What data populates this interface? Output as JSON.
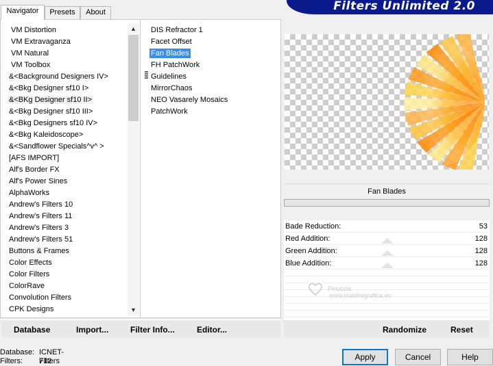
{
  "tabs": [
    "Navigator",
    "Presets",
    "About"
  ],
  "banner": {
    "title": "Filters Unlimited 2.0"
  },
  "categories": [
    "VM Distortion",
    "VM Extravaganza",
    "VM Natural",
    "VM Toolbox",
    "&<Background Designers IV>",
    "&<Bkg Designer sf10 I>",
    "&<BKg Designer sf10 II>",
    "&<Bkg Designer sf10 III>",
    "&<Bkg Designers sf10 IV>",
    "&<Bkg Kaleidoscope>",
    "&<Sandflower Specials^v^ >",
    "[AFS IMPORT]",
    "Alf's Border FX",
    "Alf's Power Sines",
    "AlphaWorks",
    "Andrew's Filters 10",
    "Andrew's Filters 11",
    "Andrew's Filters 3",
    "Andrew's Filters 51",
    "Buttons & Frames",
    "Color Effects",
    "Color Filters",
    "ColorRave",
    "Convolution Filters",
    "CPK Designs"
  ],
  "filters": [
    "DIS Refractor 1",
    "Facet Offset",
    "Fan Blades",
    "FH PatchWork",
    "Guidelines",
    "MirrorChaos",
    "NEO Vasarely Mosaics",
    "PatchWork"
  ],
  "selected_filter": "Fan Blades",
  "params": [
    {
      "name": "Bade Reduction:",
      "value": "53"
    },
    {
      "name": "Red Addition:",
      "value": "128"
    },
    {
      "name": "Green Addition:",
      "value": "128"
    },
    {
      "name": "Blue Addition:",
      "value": "128"
    }
  ],
  "watermark": {
    "line1": "Pinuccia",
    "line2": "www.maldiregrafica.eu"
  },
  "actions_left": [
    "Database",
    "Import...",
    "Filter Info...",
    "Editor..."
  ],
  "actions_right": [
    "Randomize",
    "Reset"
  ],
  "status": {
    "database_label": "Database:",
    "database_value": "ICNET-Filters",
    "filters_label": "Filters:",
    "filters_value": "712"
  },
  "buttons": {
    "apply": "Apply",
    "cancel": "Cancel",
    "help": "Help"
  },
  "colors": {
    "selection": "#3a8ee6",
    "banner": "#0a1a8a",
    "focus": "#0078d7"
  },
  "icons": {
    "scroll_up": "▲",
    "scroll_down": "▼"
  }
}
